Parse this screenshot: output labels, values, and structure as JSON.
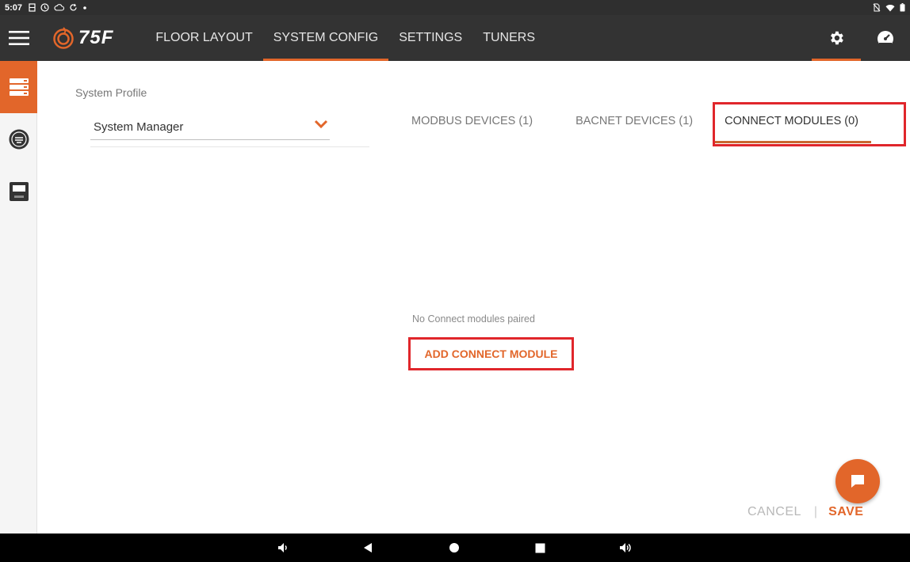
{
  "statusbar": {
    "time": "5:07"
  },
  "appbar": {
    "logo_text": "75F",
    "tabs": [
      {
        "label": "FLOOR LAYOUT"
      },
      {
        "label": "SYSTEM CONFIG"
      },
      {
        "label": "SETTINGS"
      },
      {
        "label": "TUNERS"
      }
    ]
  },
  "profile": {
    "label": "System Profile",
    "selected": "System Manager"
  },
  "subtabs": [
    {
      "label": "MODBUS DEVICES (1)"
    },
    {
      "label": "BACNET DEVICES (1)"
    },
    {
      "label": "CONNECT MODULES (0)"
    }
  ],
  "content": {
    "empty_message": "No Connect modules paired",
    "add_button": "ADD CONNECT MODULE"
  },
  "footer": {
    "cancel": "CANCEL",
    "separator": "|",
    "save": "SAVE"
  },
  "colors": {
    "accent": "#e2662a",
    "appbar_bg": "#333333",
    "highlight": "#e0262b"
  }
}
